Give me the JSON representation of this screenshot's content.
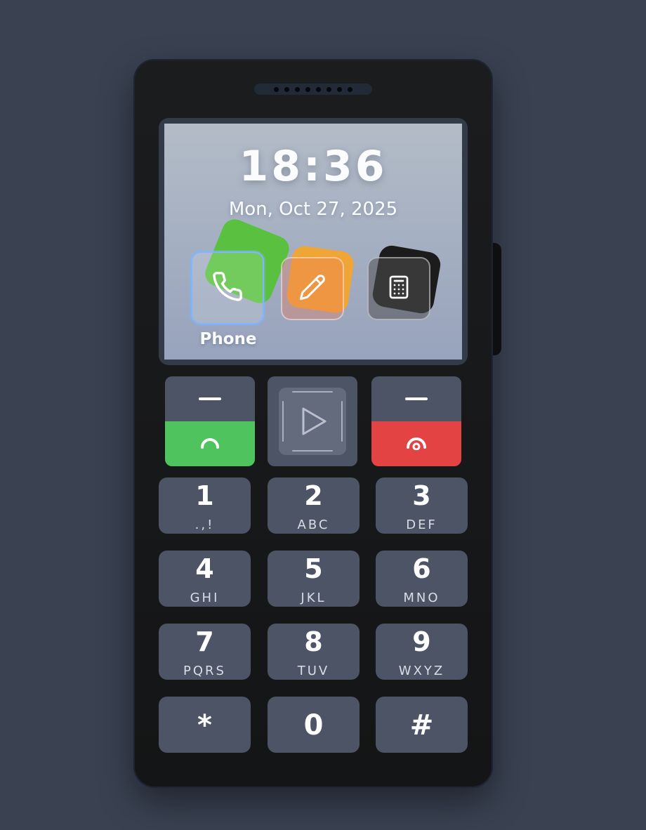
{
  "screen": {
    "time": "18:36",
    "date": "Mon, Oct 27, 2025",
    "apps": [
      {
        "name": "Phone",
        "icon": "phone-icon",
        "color": "#59c13f",
        "selected": true
      },
      {
        "name": "Notes",
        "icon": "pencil-icon",
        "color": "#f0a637",
        "selected": false
      },
      {
        "name": "Calculator",
        "icon": "calculator-icon",
        "color": "#1c1c1c",
        "selected": false
      }
    ],
    "selected_label": "Phone"
  },
  "softkeys": {
    "call_color": "#4fc45e",
    "end_color": "#e34343"
  },
  "keypad": {
    "keys": [
      {
        "digit": "1",
        "letters": ".,!"
      },
      {
        "digit": "2",
        "letters": "ABC"
      },
      {
        "digit": "3",
        "letters": "DEF"
      },
      {
        "digit": "4",
        "letters": "GHI"
      },
      {
        "digit": "5",
        "letters": "JKL"
      },
      {
        "digit": "6",
        "letters": "MNO"
      },
      {
        "digit": "7",
        "letters": "PQRS"
      },
      {
        "digit": "8",
        "letters": "TUV"
      },
      {
        "digit": "9",
        "letters": "WXYZ"
      },
      {
        "digit": "*",
        "letters": ""
      },
      {
        "digit": "0",
        "letters": ""
      },
      {
        "digit": "#",
        "letters": ""
      }
    ]
  }
}
